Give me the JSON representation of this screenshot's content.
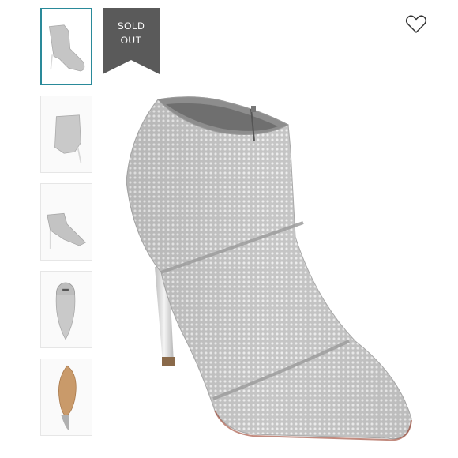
{
  "badge": {
    "line1": "SOLD",
    "line2": "OUT",
    "color": "#5a5a5a"
  },
  "thumbnails": [
    {
      "view": "angled-side",
      "selected": true
    },
    {
      "view": "back-quarter",
      "selected": false
    },
    {
      "view": "side-profile",
      "selected": false
    },
    {
      "view": "top-down",
      "selected": false
    },
    {
      "view": "sole",
      "selected": false
    }
  ],
  "icons": {
    "wishlist": "heart-outline-icon"
  },
  "colors": {
    "accent": "#2a8a9a",
    "boot": "#c9c9c9",
    "heel": "#dcdcdc"
  }
}
